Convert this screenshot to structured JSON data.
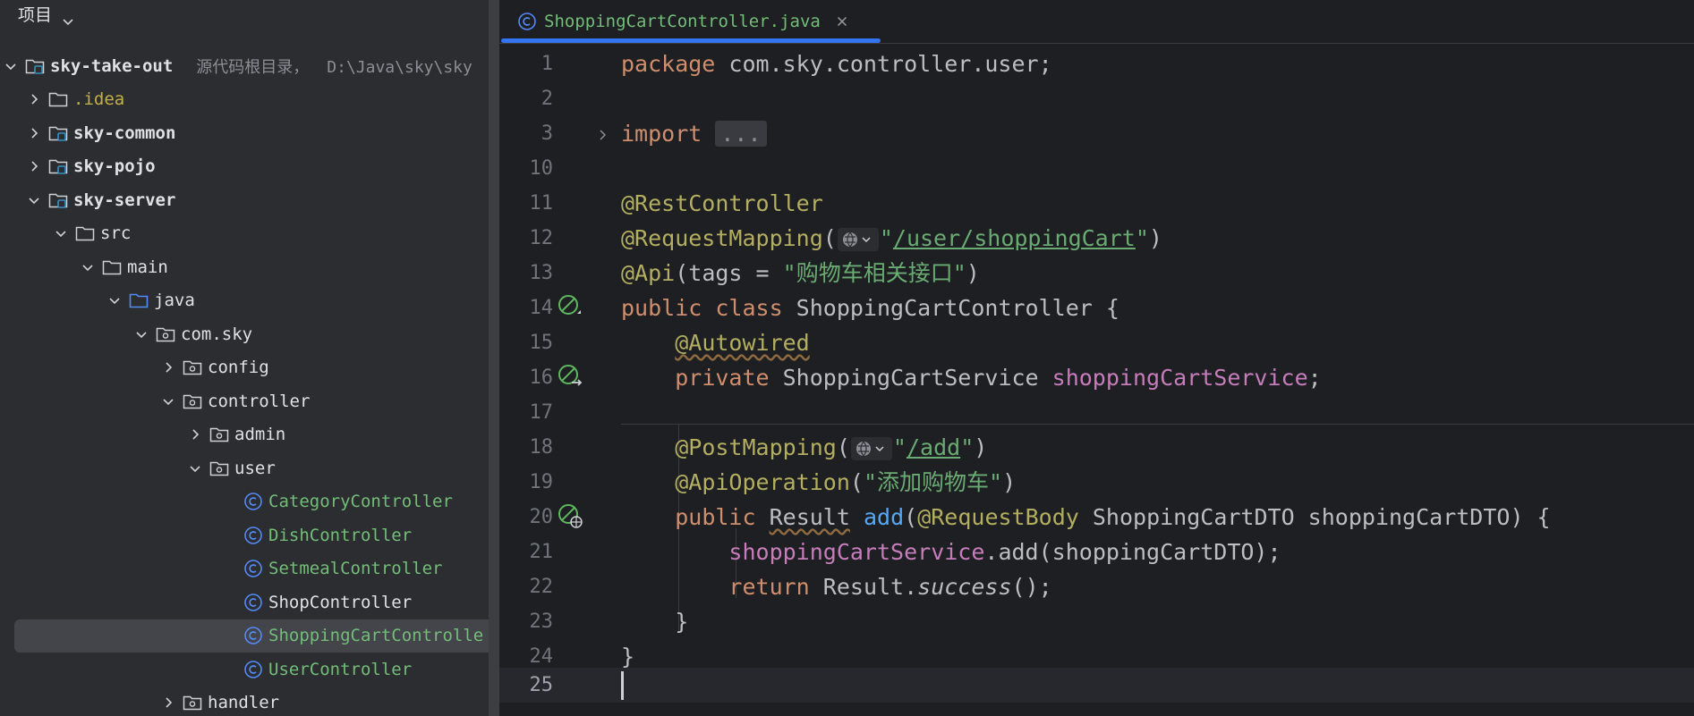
{
  "panel": {
    "title": "项目",
    "root": {
      "name": "sky-take-out",
      "hint": "源代码根目录，",
      "path": "D:\\Java\\sky\\sky"
    },
    "items": [
      {
        "name": ".idea",
        "type": "folder",
        "style": "yellow"
      },
      {
        "name": "sky-common",
        "type": "module",
        "style": "bold"
      },
      {
        "name": "sky-pojo",
        "type": "module",
        "style": "bold"
      },
      {
        "name": "sky-server",
        "type": "module",
        "style": "bold"
      },
      {
        "name": "src",
        "type": "folder"
      },
      {
        "name": "main",
        "type": "folder"
      },
      {
        "name": "java",
        "type": "source-folder"
      },
      {
        "name": "com.sky",
        "type": "package"
      },
      {
        "name": "config",
        "type": "package"
      },
      {
        "name": "controller",
        "type": "package"
      },
      {
        "name": "admin",
        "type": "package"
      },
      {
        "name": "user",
        "type": "package"
      },
      {
        "name": "CategoryController",
        "type": "class"
      },
      {
        "name": "DishController",
        "type": "class"
      },
      {
        "name": "SetmealController",
        "type": "class"
      },
      {
        "name": "ShopController",
        "type": "class"
      },
      {
        "name": "ShoppingCartControlle",
        "type": "class"
      },
      {
        "name": "UserController",
        "type": "class"
      },
      {
        "name": "handler",
        "type": "package"
      }
    ]
  },
  "editor": {
    "tab": {
      "title": "ShoppingCartController.java"
    },
    "line_numbers": [
      "1",
      "2",
      "3",
      "10",
      "11",
      "12",
      "13",
      "14",
      "15",
      "16",
      "17",
      "18",
      "19",
      "20",
      "21",
      "22",
      "23",
      "24",
      "25"
    ],
    "code": {
      "l1": {
        "kw": "package",
        "rest": " com.sky.controller.user;"
      },
      "l3": {
        "kw": "import",
        "fold": "..."
      },
      "l11": {
        "ann": "@RestController"
      },
      "l12": {
        "ann": "@RequestMapping",
        "open": "(",
        "q1": "\"",
        "path": "/user/shoppingCart",
        "q2": "\"",
        "close": ")"
      },
      "l13": {
        "ann": "@Api",
        "pre": "(tags = ",
        "str": "\"购物车相关接口\"",
        "close": ")"
      },
      "l14": {
        "kw": "public class",
        "rest": " ShoppingCartController {"
      },
      "l15": {
        "ann": "@Autowired"
      },
      "l16": {
        "kw": "private",
        "type": " ShoppingCartService ",
        "field": "shoppingCartService",
        "end": ";"
      },
      "l18": {
        "ann": "@PostMapping",
        "open": "(",
        "q1": "\"",
        "path": "/add",
        "q2": "\"",
        "close": ")"
      },
      "l19": {
        "ann": "@ApiOperation",
        "open": "(",
        "str": "\"添加购物车\"",
        "close": ")"
      },
      "l20": {
        "kw": "public",
        "type": "Result",
        "fn": "add",
        "open": "(",
        "ann": "@RequestBody",
        "rest": " ShoppingCartDTO shoppingCartDTO) {"
      },
      "l21": {
        "field": "shoppingCartService",
        "rest": ".add(shoppingCartDTO);"
      },
      "l22": {
        "kw": "return",
        "obj": " Result.",
        "call": "success",
        "rest": "();"
      },
      "l23": {
        "text": "}"
      },
      "l24": {
        "text": "}"
      }
    }
  }
}
